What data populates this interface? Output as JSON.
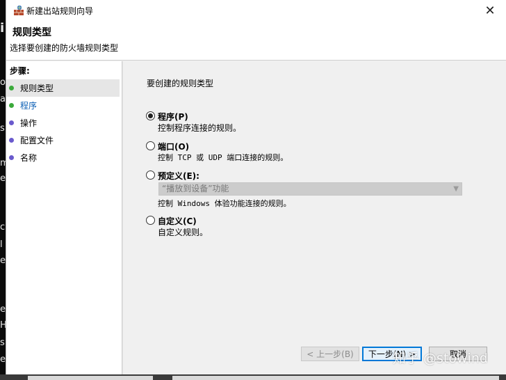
{
  "window": {
    "title": "新建出站规则向导",
    "close_glyph": "✕"
  },
  "header": {
    "title": "规则类型",
    "subtitle": "选择要创建的防火墙规则类型"
  },
  "steps": {
    "title": "步骤:",
    "items": [
      {
        "label": "规则类型",
        "dot_color": "#3caa3c"
      },
      {
        "label": "程序",
        "dot_color": "#3caa3c"
      },
      {
        "label": "操作",
        "dot_color": "#6a5acd"
      },
      {
        "label": "配置文件",
        "dot_color": "#6a5acd"
      },
      {
        "label": "名称",
        "dot_color": "#6a5acd"
      }
    ]
  },
  "main": {
    "prompt": "要创建的规则类型",
    "options": [
      {
        "label": "程序(P)",
        "desc": "控制程序连接的规则。",
        "checked": true
      },
      {
        "label": "端口(O)",
        "desc": "控制 TCP 或 UDP 端口连接的规则。",
        "checked": false
      },
      {
        "label": "预定义(E):",
        "desc": "控制 Windows 体验功能连接的规则。",
        "checked": false
      },
      {
        "label": "自定义(C)",
        "desc": "自定义规则。",
        "checked": false
      }
    ],
    "preset_value": "“播放到设备”功能"
  },
  "buttons": {
    "back": "< 上一步(B)",
    "next": "下一步(N) >",
    "cancel": "取消"
  },
  "watermark": "知乎 @stowind",
  "background_chars": [
    "i",
    "o",
    "a",
    "s",
    "m",
    "e",
    "c",
    "l",
    "e",
    "e",
    "H",
    "s",
    "e"
  ],
  "colors": {
    "accent": "#0078d7",
    "current_step": "#0b5fb5"
  }
}
